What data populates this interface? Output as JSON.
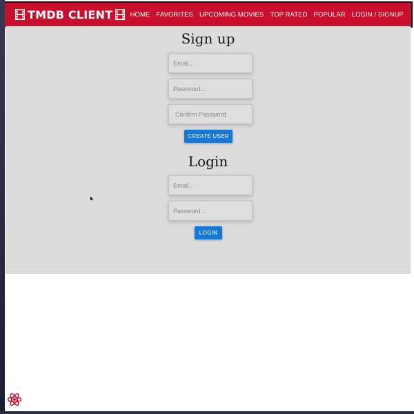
{
  "navbar": {
    "brand": "TMDB CLIENT",
    "brand_color": "#c8102e",
    "links": [
      {
        "label": "HOME"
      },
      {
        "label": "FAVORITES"
      },
      {
        "label": "UPCOMING MOVIES"
      },
      {
        "label": "TOP RATED"
      },
      {
        "label": "POPULAR"
      },
      {
        "label": "LOGIN / SIGNUP"
      }
    ]
  },
  "signup": {
    "title": "Sign up",
    "email_placeholder": "Email...",
    "password_placeholder": "Password...",
    "confirm_placeholder": "Confirm Password",
    "button_label": "CREATE USER"
  },
  "login": {
    "title": "Login",
    "email_placeholder": "Email...",
    "password_placeholder": "Password...",
    "button_label": "LOGIN"
  },
  "colors": {
    "button": "#1976d2",
    "panel": "#dcdcdc"
  },
  "icons": [
    "film-strip-icon",
    "mouse-cursor-icon",
    "react-devtools-icon"
  ]
}
